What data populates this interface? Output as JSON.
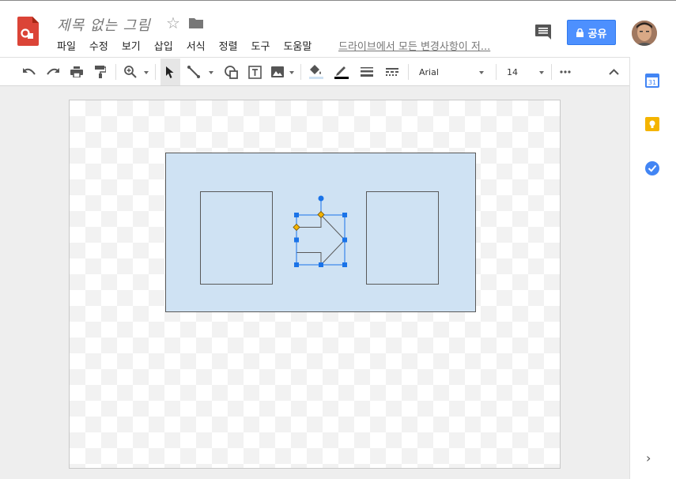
{
  "app": {
    "document_title": "제목 없는 그림",
    "save_status": "드라이브에서 모든 변경사항이 저...",
    "share_label": "공유"
  },
  "menu": {
    "items": [
      "파일",
      "수정",
      "보기",
      "삽입",
      "서식",
      "정렬",
      "도구",
      "도움말"
    ]
  },
  "toolbar": {
    "font_name": "Arial",
    "font_size": "14",
    "icons": [
      "undo-icon",
      "redo-icon",
      "print-icon",
      "paint-format-icon",
      "zoom-icon",
      "select-icon",
      "line-icon",
      "shape-icon",
      "textbox-icon",
      "image-icon",
      "fill-color-icon",
      "line-color-icon",
      "line-weight-icon",
      "line-dash-icon",
      "more-icon",
      "collapse-icon"
    ]
  },
  "side_panel": {
    "calendar_label": "31",
    "icons": [
      "calendar-icon",
      "keep-icon",
      "tasks-icon",
      "expand-panel-icon"
    ]
  },
  "colors": {
    "accent_blue": "#4d90fe",
    "shape_fill": "#cfe2f3",
    "shape_stroke": "#595959",
    "selection": "#1a73e8",
    "handle_yellow": "#f4b400",
    "app_red": "#db4437"
  }
}
